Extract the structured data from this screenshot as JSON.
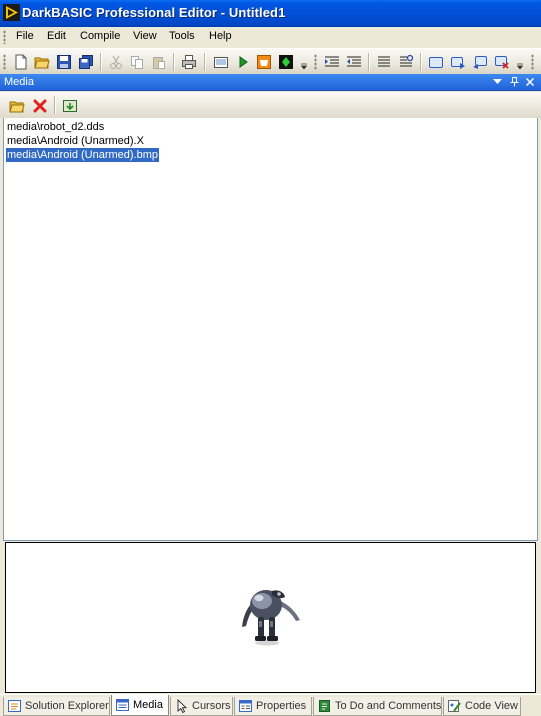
{
  "window": {
    "title": "DarkBASIC Professional Editor - Untitled1",
    "icon": "darkbasic-app-icon"
  },
  "menu": [
    {
      "label": "File",
      "name": "menu-file"
    },
    {
      "label": "Edit",
      "name": "menu-edit"
    },
    {
      "label": "Compile",
      "name": "menu-compile"
    },
    {
      "label": "View",
      "name": "menu-view"
    },
    {
      "label": "Tools",
      "name": "menu-tools"
    },
    {
      "label": "Help",
      "name": "menu-help"
    }
  ],
  "toolbar": {
    "buttons": [
      "new-file-icon",
      "open-folder-icon",
      "save-icon",
      "save-all-icon",
      "cut-icon",
      "copy-icon",
      "paste-icon",
      "print-icon",
      "build-exe-icon",
      "run-icon",
      "compile-icon",
      "media-icon",
      "indent-icon",
      "outdent-icon",
      "align-icon",
      "find-icon",
      "window-icon",
      "forward-icon",
      "reply-icon",
      "close-window-icon"
    ]
  },
  "pane": {
    "title": "Media",
    "controls": [
      "dropdown-arrow-icon",
      "pin-icon",
      "close-icon"
    ],
    "tools": [
      "open-folder-icon",
      "delete-icon",
      "import-media-icon"
    ]
  },
  "files": [
    {
      "path": "media\\robot_d2.dds",
      "selected": false
    },
    {
      "path": "media\\Android (Unarmed).X",
      "selected": false
    },
    {
      "path": "media\\Android (Unarmed).bmp",
      "selected": true
    }
  ],
  "preview": {
    "content": "android-robot-model-icon"
  },
  "tabs": [
    {
      "label": "Solution Explorer",
      "icon": "solution-explorer-icon",
      "active": false
    },
    {
      "label": "Media",
      "icon": "media-list-icon",
      "active": true
    },
    {
      "label": "Cursors",
      "icon": "cursor-icon",
      "active": false
    },
    {
      "label": "Properties",
      "icon": "properties-icon",
      "active": false
    },
    {
      "label": "To Do and Comments",
      "icon": "todo-icon",
      "active": false
    },
    {
      "label": "Code View",
      "icon": "code-view-icon",
      "active": false
    }
  ],
  "colors": {
    "titlebar": "#0150d6",
    "pane_header": "#2d6fe0",
    "selection": "#316ac5",
    "chrome": "#ece9d8"
  }
}
